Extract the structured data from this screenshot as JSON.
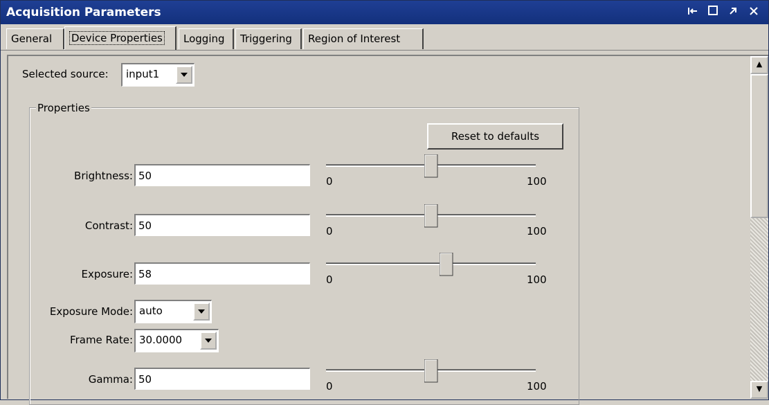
{
  "window": {
    "title": "Acquisition Parameters"
  },
  "titlebar_buttons": [
    "dock-icon",
    "maximize-icon",
    "undock-icon",
    "close-icon"
  ],
  "tabs": [
    "General",
    "Device Properties",
    "Logging",
    "Triggering",
    "Region of Interest"
  ],
  "active_tab": "Device Properties",
  "source": {
    "label": "Selected source:",
    "value": "input1"
  },
  "properties": {
    "group_label": "Properties",
    "reset_label": "Reset to defaults",
    "brightness": {
      "label": "Brightness:",
      "value": "50",
      "min": "0",
      "max": "100",
      "level": 0.5
    },
    "contrast": {
      "label": "Contrast:",
      "value": "50",
      "min": "0",
      "max": "100",
      "level": 0.5
    },
    "exposure": {
      "label": "Exposure:",
      "value": "58",
      "min": "0",
      "max": "100",
      "level": 0.58
    },
    "exposure_mode": {
      "label": "Exposure Mode:",
      "value": "auto"
    },
    "frame_rate": {
      "label": "Frame Rate:",
      "value": "30.0000"
    },
    "gamma": {
      "label": "Gamma:",
      "value": "50",
      "min": "0",
      "max": "100",
      "level": 0.5
    }
  },
  "colors": {
    "titlebar": "#1f3f94",
    "panel": "#d4d0c8"
  }
}
